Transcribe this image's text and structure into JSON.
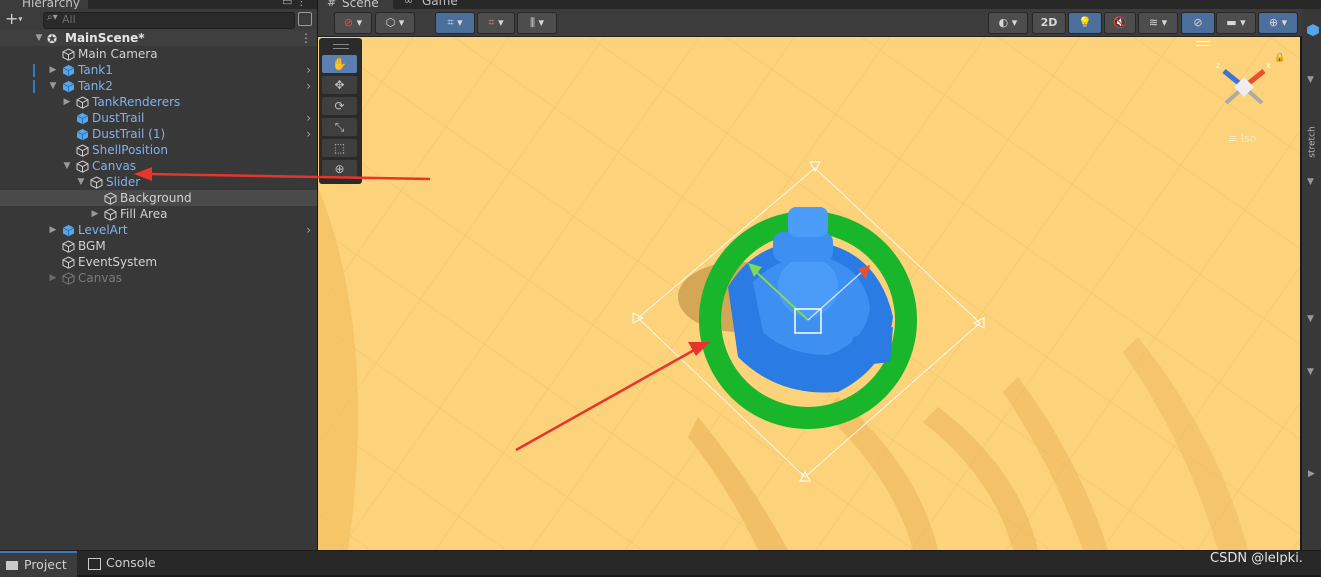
{
  "hierarchy": {
    "tab_label": "Hierarchy",
    "search_placeholder": "All",
    "scene_name": "MainScene*",
    "items": [
      {
        "label": "Main Camera",
        "style": "normal"
      },
      {
        "label": "Tank1",
        "style": "prefab"
      },
      {
        "label": "Tank2",
        "style": "prefab"
      },
      {
        "label": "TankRenderers",
        "style": "prefab"
      },
      {
        "label": "DustTrail",
        "style": "prefab"
      },
      {
        "label": "DustTrail (1)",
        "style": "prefab"
      },
      {
        "label": "ShellPosition",
        "style": "prefab"
      },
      {
        "label": "Canvas",
        "style": "prefab"
      },
      {
        "label": "Slider",
        "style": "prefab"
      },
      {
        "label": "Background",
        "style": "normal"
      },
      {
        "label": "Fill Area",
        "style": "normal"
      },
      {
        "label": "LevelArt",
        "style": "prefab"
      },
      {
        "label": "BGM",
        "style": "normal"
      },
      {
        "label": "EventSystem",
        "style": "normal"
      },
      {
        "label": "Canvas",
        "style": "disabled"
      }
    ]
  },
  "scene_view": {
    "tabs": [
      "Scene",
      "Game"
    ],
    "toolbar": {
      "toggle_2d": "2D"
    },
    "side_label": "stretch",
    "gizmo": {
      "x_label": "x",
      "z_label": "z",
      "persp_label": "Iso"
    }
  },
  "bottom": {
    "tabs": [
      "Project",
      "Console"
    ]
  },
  "watermark": "CSDN @lelpki.",
  "colors": {
    "viewport_bg": "#fcd27a",
    "tank_blue": "#2a7be4",
    "health_ring": "#19b52a",
    "annotation_arrow": "#e8352b",
    "prefab_text": "#7fb2ef",
    "selection_blue": "#3a79bb"
  }
}
